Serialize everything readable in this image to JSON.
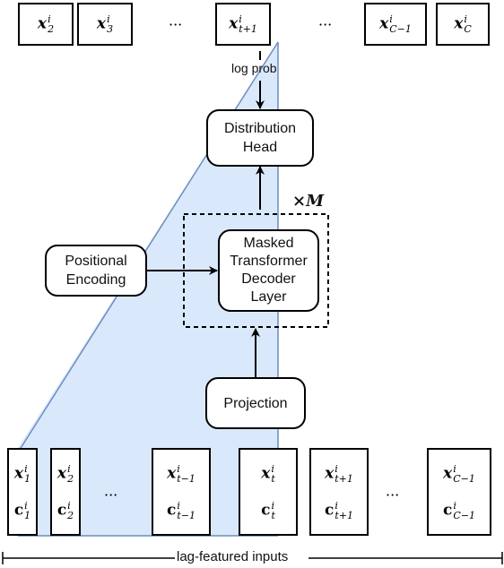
{
  "outputs": [
    {
      "var": "x",
      "sup": "i",
      "sub": "2"
    },
    {
      "var": "x",
      "sup": "i",
      "sub": "3"
    },
    {
      "var": "x",
      "sup": "i",
      "sub": "t+1"
    },
    {
      "var": "x",
      "sup": "i",
      "sub": "C−1"
    },
    {
      "var": "x",
      "sup": "i",
      "sub": "C"
    }
  ],
  "ellipsis": "···",
  "log_prob_label": "log prob",
  "distribution_head": {
    "line1": "Distribution",
    "line2": "Head"
  },
  "repeat_label": "×M",
  "decoder_layer": {
    "line1": "Masked",
    "line2": "Transformer",
    "line3": "Decoder",
    "line4": "Layer"
  },
  "positional_encoding": {
    "line1": "Positional",
    "line2": "Encoding"
  },
  "projection": "Projection",
  "inputs": [
    {
      "x_sub": "1",
      "c_sub": "1"
    },
    {
      "x_sub": "2",
      "c_sub": "2"
    },
    {
      "x_sub": "t−1",
      "c_sub": "t−1"
    },
    {
      "x_sub": "t",
      "c_sub": "t"
    },
    {
      "x_sub": "t+1",
      "c_sub": "t+1"
    },
    {
      "x_sub": "C−1",
      "c_sub": "C−1"
    }
  ],
  "input_sup": "i",
  "x_var": "x",
  "c_var": "c",
  "bracket_label": "lag-featured inputs",
  "colors": {
    "attention_fill": "#dae8fc",
    "attention_stroke": "#6c8ebf"
  }
}
